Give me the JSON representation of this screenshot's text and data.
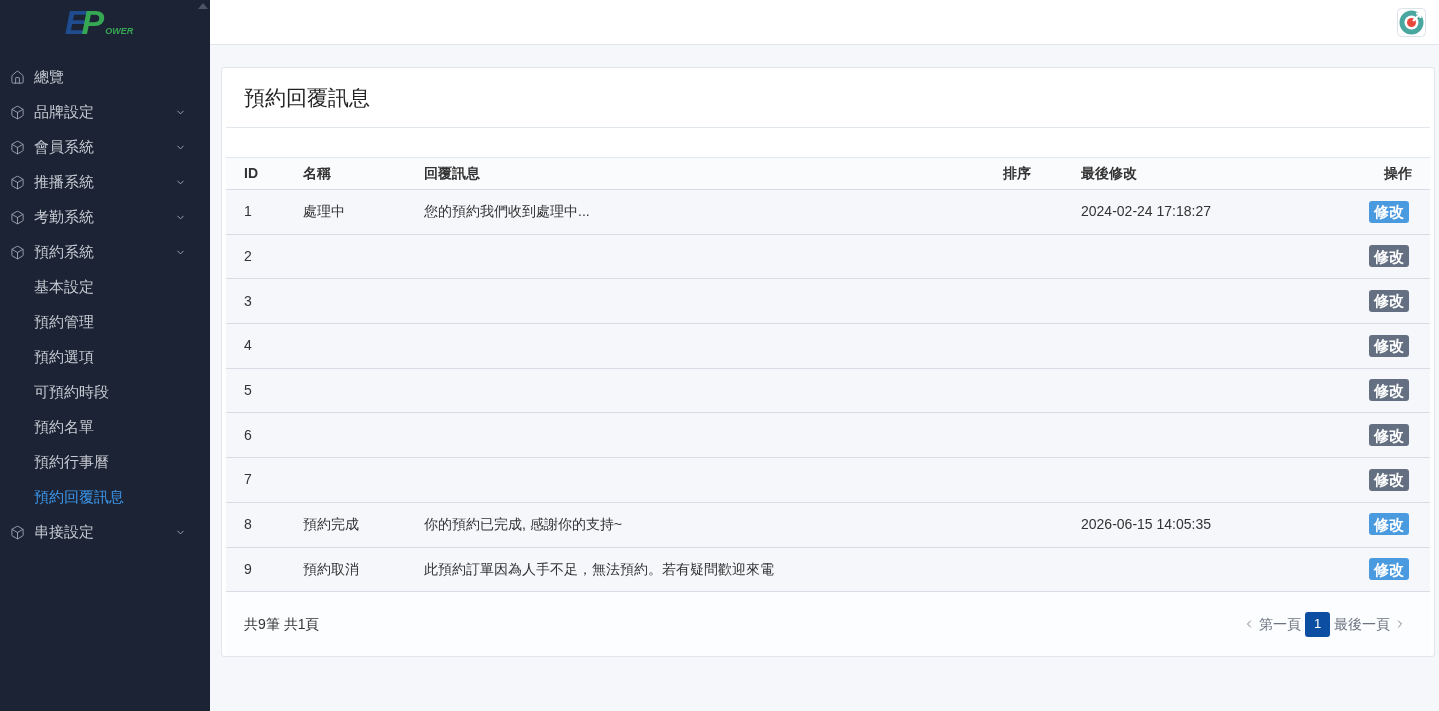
{
  "sidebar": {
    "logo": [
      "E",
      "P",
      "OWER"
    ],
    "items": [
      {
        "label": "總覽",
        "kind": "link"
      },
      {
        "label": "品牌設定",
        "kind": "group"
      },
      {
        "label": "會員系統",
        "kind": "group"
      },
      {
        "label": "推播系統",
        "kind": "group"
      },
      {
        "label": "考勤系統",
        "kind": "group"
      },
      {
        "label": "預約系統",
        "kind": "group",
        "children": [
          {
            "label": "基本設定",
            "selected": false
          },
          {
            "label": "預約管理",
            "selected": false
          },
          {
            "label": "預約選項",
            "selected": false
          },
          {
            "label": "可預約時段",
            "selected": false
          },
          {
            "label": "預約名單",
            "selected": false
          },
          {
            "label": "預約行事曆",
            "selected": false
          },
          {
            "label": "預約回覆訊息",
            "selected": true
          }
        ]
      },
      {
        "label": "串接設定",
        "kind": "group"
      }
    ]
  },
  "page": {
    "title": "預約回覆訊息"
  },
  "table": {
    "columns": [
      "ID",
      "名稱",
      "回覆訊息",
      "排序",
      "最後修改",
      "操作"
    ],
    "rows": [
      {
        "id": "1",
        "name": "處理中",
        "message": "您的預約我們收到處理中...",
        "modified": "2024-02-24 17:18:27",
        "action": {
          "label": "修改",
          "color": "#4a9ae0"
        }
      },
      {
        "id": "2",
        "action": {
          "label": "修改",
          "color": "#647082"
        }
      },
      {
        "id": "3",
        "action": {
          "label": "修改",
          "color": "#647082"
        }
      },
      {
        "id": "4",
        "action": {
          "label": "修改",
          "color": "#647082"
        }
      },
      {
        "id": "5",
        "action": {
          "label": "修改",
          "color": "#647082"
        }
      },
      {
        "id": "6",
        "action": {
          "label": "修改",
          "color": "#647082"
        }
      },
      {
        "id": "7",
        "action": {
          "label": "修改",
          "color": "#647082"
        }
      },
      {
        "id": "8",
        "name": "預約完成",
        "message": "你的預約已完成, 感謝你的支持~",
        "modified": "2026-06-15 14:05:35",
        "action": {
          "label": "修改",
          "color": "#4a9ae0"
        }
      },
      {
        "id": "9",
        "name": "預約取消",
        "message": "此預約訂單因為人手不足，無法預約。若有疑問歡迎來電",
        "action": {
          "label": "修改",
          "color": "#4a9ae0"
        }
      }
    ]
  },
  "footer": {
    "summary": "共9筆 共1頁",
    "first": "第一頁",
    "pages": [
      {
        "label": "1",
        "selected": true
      }
    ],
    "last": "最後一頁"
  }
}
